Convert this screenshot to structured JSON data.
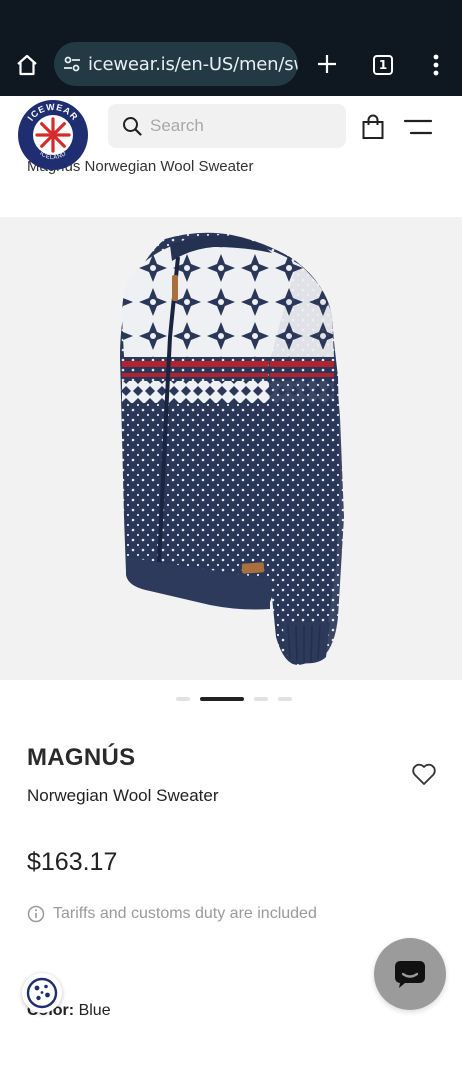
{
  "browser": {
    "url": "icewear.is/en-US/men/sw",
    "tab_count": "1"
  },
  "header": {
    "logo_text_top": "ICEWEAR",
    "logo_text_bottom": "ICELAND",
    "search_placeholder": "Search"
  },
  "breadcrumb": {
    "text": "Magnús Norwegian Wool Sweater"
  },
  "gallery": {
    "slide_count": 4,
    "active_index": 1
  },
  "product": {
    "title": "MAGNÚS",
    "subtitle": "Norwegian Wool Sweater",
    "price": "$163.17",
    "tariff_note": "Tariffs and customs duty are included",
    "color_label": "Color:",
    "color_value": "Blue"
  },
  "colors": {
    "browser_bar": "#0f1720",
    "url_pill": "#233a45",
    "logo_blue": "#1e2e70",
    "logo_red": "#d42a2a",
    "sweater_navy": "#2a3758",
    "sweater_red": "#b2232f",
    "chat_button": "#9b9b9b"
  },
  "icons": {
    "home": "home-icon",
    "site_settings": "tune-icon",
    "new_tab": "plus-icon",
    "tabs": "tab-switcher-icon",
    "browser_menu": "kebab-menu-icon",
    "search": "search-icon",
    "bag": "shopping-bag-icon",
    "menu": "hamburger-icon",
    "wishlist": "heart-icon",
    "info": "info-icon",
    "cookie": "cookie-icon",
    "chat": "chat-icon"
  }
}
